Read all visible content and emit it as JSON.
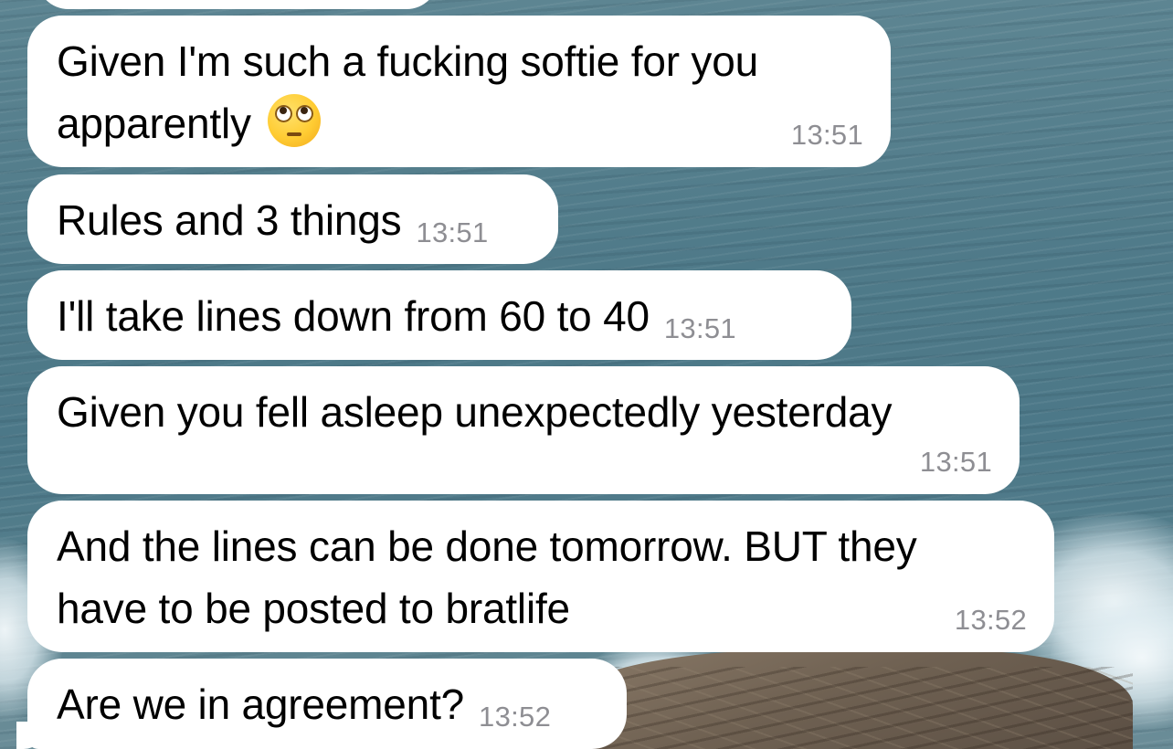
{
  "messages": [
    {
      "text": "",
      "time": ""
    },
    {
      "text": "Given I'm such a fucking softie for you",
      "text2": "apparently",
      "emoji": "face-with-rolling-eyes",
      "time": "13:51"
    },
    {
      "text": "Rules and 3 things",
      "time": "13:51"
    },
    {
      "text": "I'll take lines down from 60 to 40",
      "time": "13:51"
    },
    {
      "text": "Given you fell asleep unexpectedly yesterday",
      "time": "13:51"
    },
    {
      "text": "And the lines can be done tomorrow. BUT they",
      "text2": "have to be posted to bratlife",
      "time": "13:52"
    },
    {
      "text": "Are we in agreement?",
      "time": "13:52"
    }
  ],
  "colors": {
    "bubble": "#ffffff",
    "timestamp": "#8e8e93",
    "text": "#000000"
  },
  "wallpaper": "sea-and-rocks-photo"
}
